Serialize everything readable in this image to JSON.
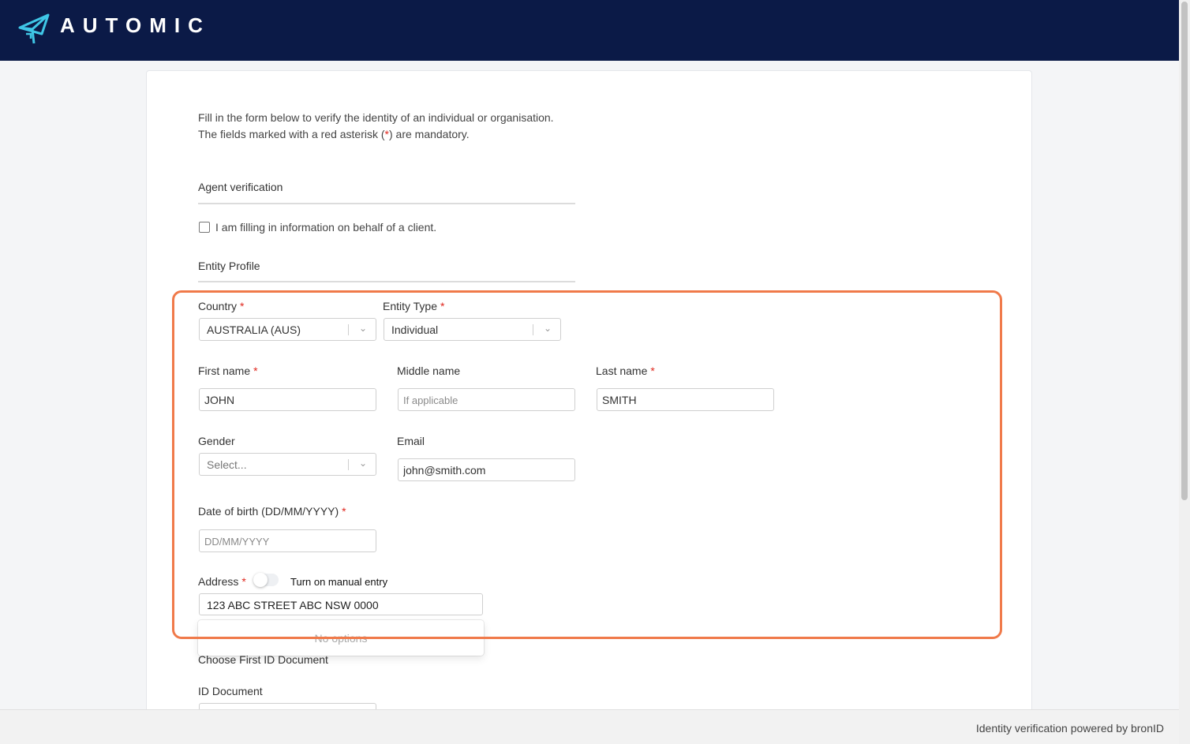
{
  "header": {
    "brand": "AUTOMIC",
    "logo_icon": "automic-logo-icon",
    "background": "#0b1a47"
  },
  "intro": {
    "line1": "Fill in the form below to verify the identity of an individual or organisation.",
    "line2_before": "The fields marked with a red asterisk (",
    "line2_asterisk": "*",
    "line2_after": ") are mandatory."
  },
  "agent_section": {
    "title": "Agent verification",
    "checkbox_label": "I am filling in information on behalf of a client.",
    "checked": false
  },
  "entity_section": {
    "title": "Entity Profile"
  },
  "form": {
    "required_mark": "*",
    "country": {
      "label": "Country",
      "value": "AUSTRALIA (AUS)"
    },
    "entity_type": {
      "label": "Entity Type",
      "value": "Individual"
    },
    "first_name": {
      "label": "First name",
      "value": "JOHN"
    },
    "middle_name": {
      "label": "Middle name",
      "value": "",
      "placeholder": "If applicable"
    },
    "last_name": {
      "label": "Last name",
      "value": "SMITH"
    },
    "gender": {
      "label": "Gender",
      "placeholder": "Select..."
    },
    "email": {
      "label": "Email",
      "value": "john@smith.com"
    },
    "dob": {
      "label": "Date of birth (DD/MM/YYYY)",
      "value": "",
      "placeholder": "DD/MM/YYYY"
    },
    "address": {
      "label": "Address",
      "toggle_label": "Turn on manual entry",
      "toggle_on": false,
      "value": "123 ABC STREET ABC NSW 0000",
      "dropdown_message": "No options"
    }
  },
  "id_section": {
    "title": "Choose First ID Document",
    "id_document_label": "ID Document"
  },
  "highlight_color": "#f07a4a",
  "footer": {
    "text": "Identity verification powered by bronID"
  }
}
